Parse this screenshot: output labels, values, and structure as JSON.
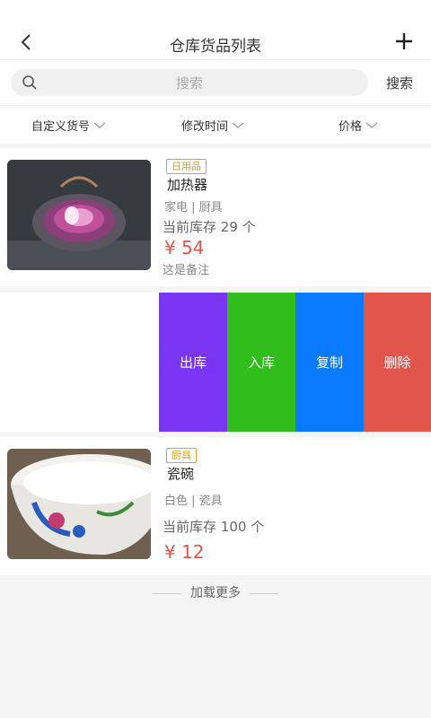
{
  "header": {
    "title": "仓库货品列表",
    "back_icon": "chevron-left-icon",
    "add_icon": "plus-icon"
  },
  "search": {
    "placeholder": "搜索",
    "button_label": "搜索",
    "icon": "search-icon"
  },
  "filters": [
    {
      "label": "自定义货号"
    },
    {
      "label": "修改时间"
    },
    {
      "label": "价格"
    }
  ],
  "items": [
    {
      "tag": "日用品",
      "name": "加热器",
      "category": "家电 | 厨具",
      "stock_prefix": "当前库存",
      "stock_count": "29",
      "stock_unit": "个",
      "price": "¥ 54",
      "remark": "这是备注"
    },
    {
      "tag": "厨具",
      "name": "瓷碗",
      "category": "白色 | 瓷具",
      "stock_prefix": "当前库存",
      "stock_count": "100",
      "stock_unit": "个",
      "price": "¥ 12"
    }
  ],
  "actions": [
    {
      "label": "出库",
      "color": "#7a35f5"
    },
    {
      "label": "入库",
      "color": "#2fbe1a"
    },
    {
      "label": "复制",
      "color": "#0a7bff"
    },
    {
      "label": "删除",
      "color": "#e2554a"
    }
  ],
  "footer": {
    "load_more": "加载更多"
  }
}
